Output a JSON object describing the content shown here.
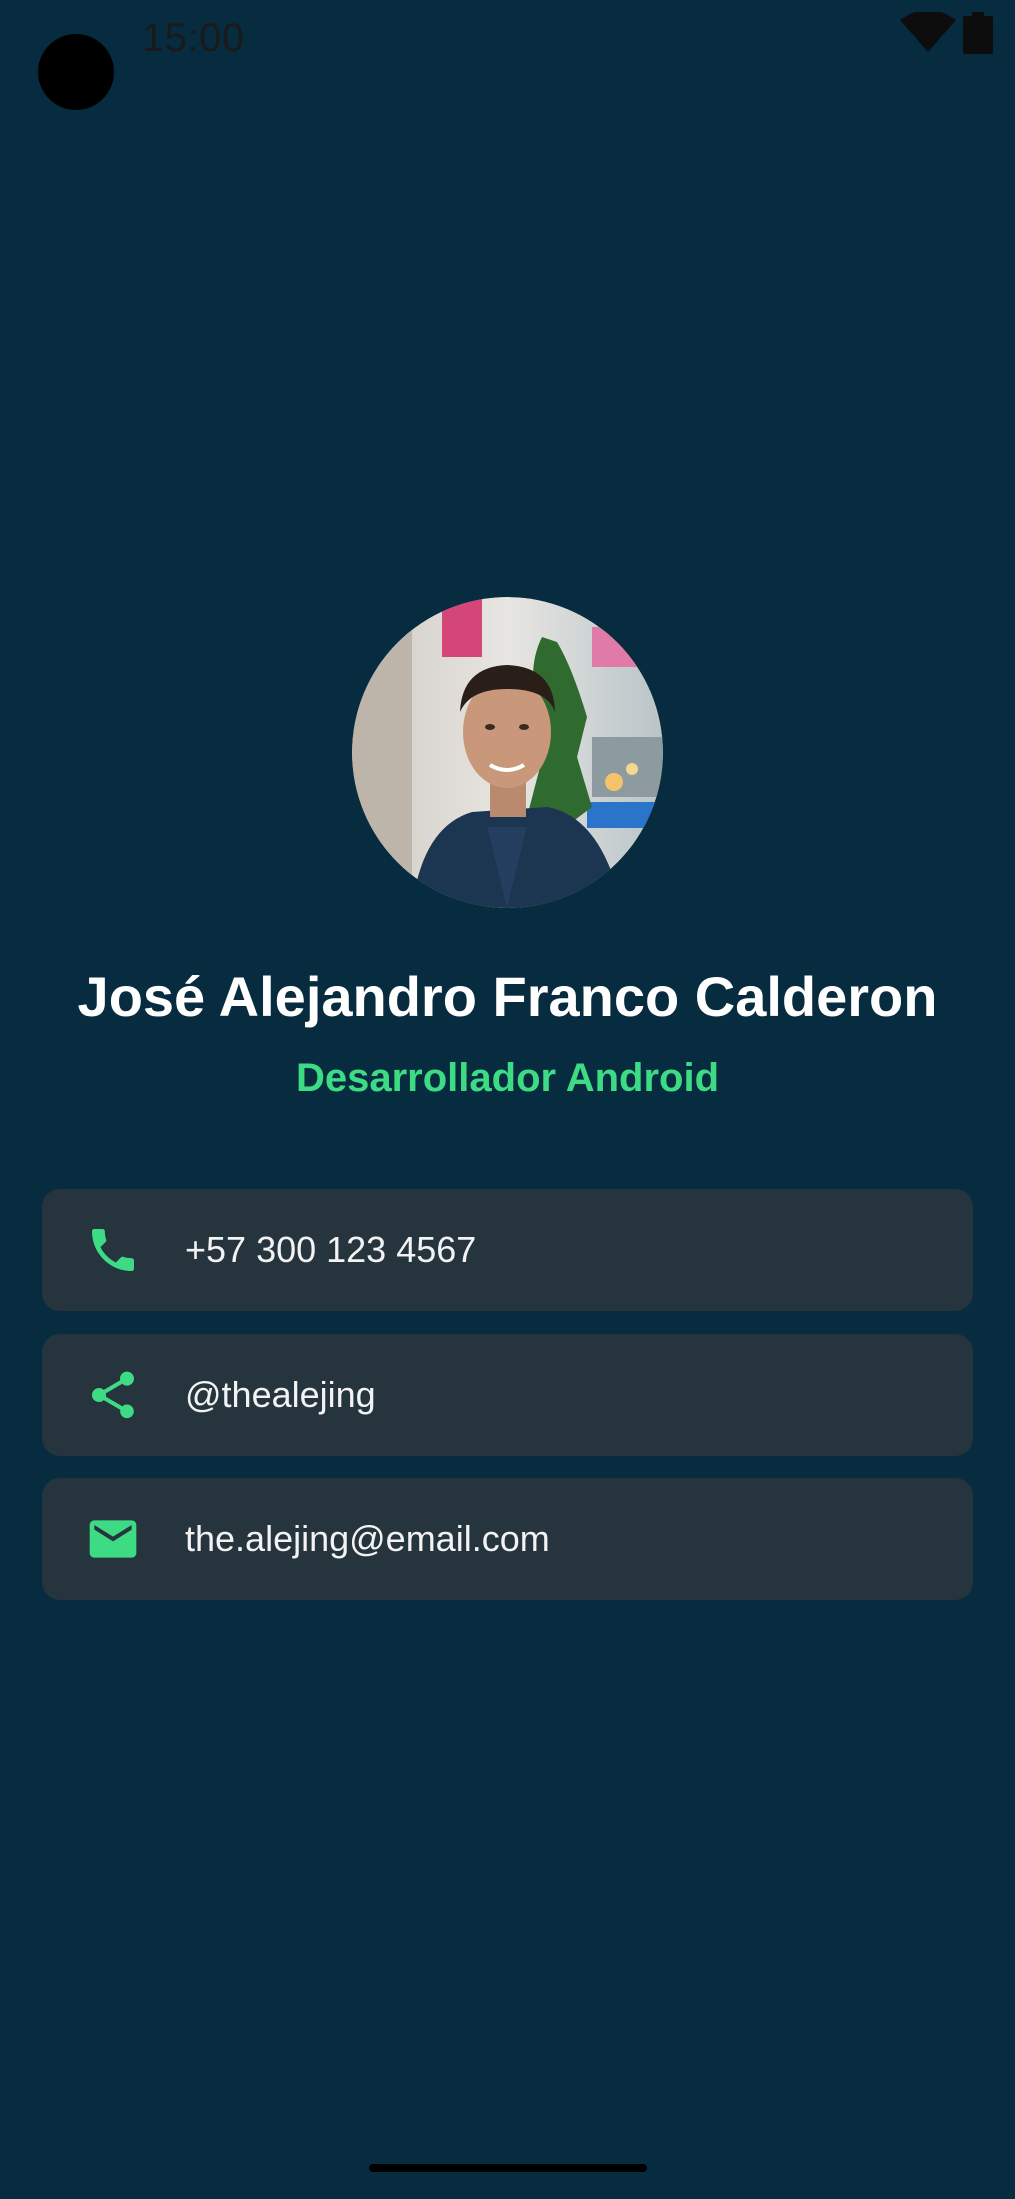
{
  "status_bar": {
    "time": "15:00"
  },
  "profile": {
    "name": "José Alejandro Franco Calderon",
    "role": "Desarrollador Android"
  },
  "contacts": [
    {
      "icon": "phone-icon",
      "value": "+57 300 123 4567"
    },
    {
      "icon": "share-icon",
      "value": "@thealejing"
    },
    {
      "icon": "email-icon",
      "value": "the.alejing@email.com"
    }
  ],
  "colors": {
    "background": "#072b3f",
    "card": "#26353d",
    "accent": "#3ddc84",
    "text": "#ffffff"
  }
}
